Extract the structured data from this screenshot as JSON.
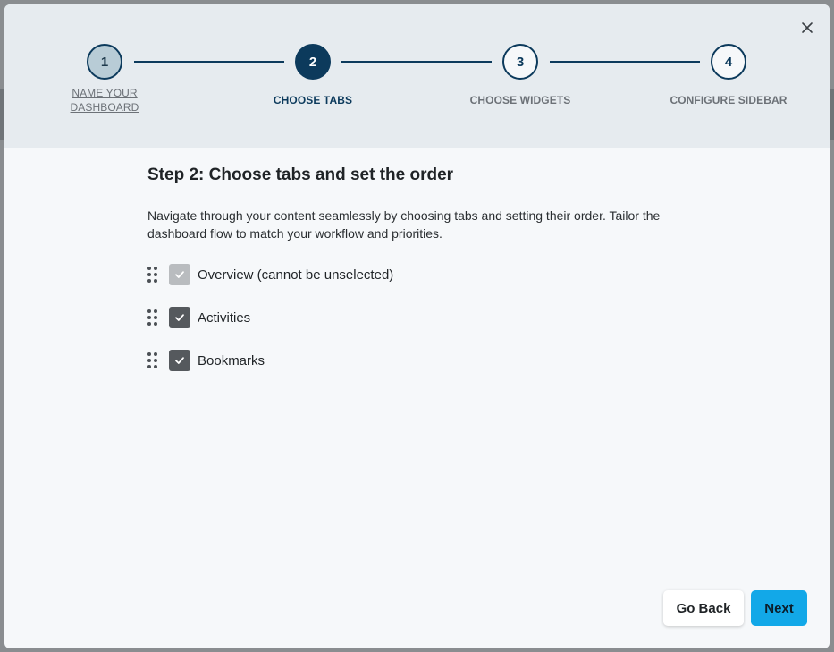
{
  "colors": {
    "primary_dark": "#0c3a5c",
    "accent_blue": "#12a8e8",
    "checkbox_checked": "#55595d",
    "checkbox_disabled": "#b9bcbf"
  },
  "dialog": {
    "close_icon": "close-icon"
  },
  "stepper": {
    "steps": [
      {
        "number": "1",
        "label": "NAME YOUR DASHBOARD",
        "state": "done"
      },
      {
        "number": "2",
        "label": "CHOOSE TABS",
        "state": "active"
      },
      {
        "number": "3",
        "label": "CHOOSE WIDGETS",
        "state": "upcoming"
      },
      {
        "number": "4",
        "label": "CONFIGURE SIDEBAR",
        "state": "upcoming"
      }
    ]
  },
  "content": {
    "title": "Step 2: Choose tabs and set the order",
    "description": "Navigate through your content seamlessly by choosing tabs and setting their order. Tailor the dashboard flow to match your workflow and priorities.",
    "tabs": [
      {
        "label": "Overview (cannot be unselected)",
        "checked": true,
        "disabled": true
      },
      {
        "label": "Activities",
        "checked": true,
        "disabled": false
      },
      {
        "label": "Bookmarks",
        "checked": true,
        "disabled": false
      }
    ]
  },
  "footer": {
    "back_label": "Go Back",
    "next_label": "Next"
  }
}
